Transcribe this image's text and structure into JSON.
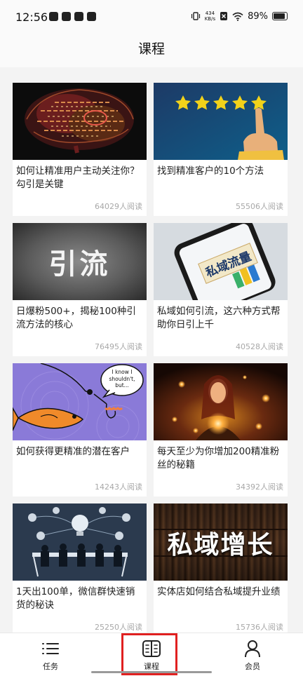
{
  "status": {
    "time": "12:56",
    "net_top": "434",
    "net_bottom": "KB/s",
    "battery": "89%"
  },
  "page_title": "课程",
  "cards": [
    {
      "title": "如何让精准用户主动关注你？勾引是关键",
      "reads": "64029人阅读",
      "thumb_icon": "brain-word-cloud-image"
    },
    {
      "title": "找到精准客户的10个方法",
      "reads": "55506人阅读",
      "thumb_icon": "five-stars-image"
    },
    {
      "title": "日爆粉500+，揭秘100种引流方法的核心",
      "reads": "76495人阅读",
      "thumb_text": "引流",
      "thumb_icon": "yinliu-text-image"
    },
    {
      "title": "私域如何引流，这六种方式帮助你日引上千",
      "reads": "40528人阅读",
      "thumb_text": "私域流量",
      "thumb_icon": "phone-image"
    },
    {
      "title": "如何获得更精准的潜在客户",
      "reads": "14243人阅读",
      "thumb_bubble": "I know I shouldn't, but...",
      "thumb_icon": "fish-hook-image"
    },
    {
      "title": "每天至少为你增加200精准粉丝的秘籍",
      "reads": "34392人阅读",
      "thumb_icon": "woman-lights-image"
    },
    {
      "title": "1天出100单，微信群快速销货的秘诀",
      "reads": "25250人阅读",
      "thumb_icon": "meeting-image"
    },
    {
      "title": "实体店如何结合私域提升业绩",
      "reads": "15736人阅读",
      "thumb_text": "私域增长",
      "thumb_icon": "bookshelf-image"
    }
  ],
  "nav": [
    {
      "label": "任务",
      "icon": "list-icon"
    },
    {
      "label": "课程",
      "icon": "book-icon"
    },
    {
      "label": "会员",
      "icon": "person-icon"
    }
  ]
}
